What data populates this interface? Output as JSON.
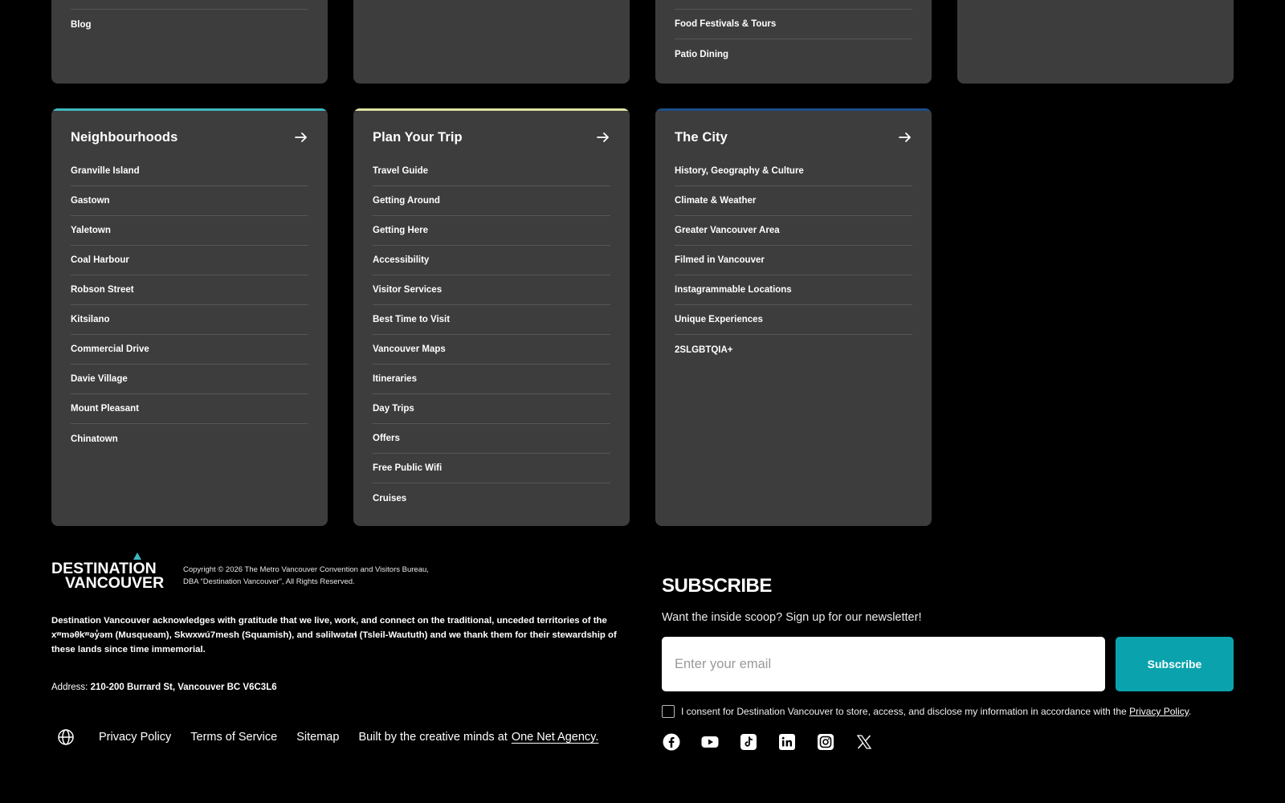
{
  "top_cards": {
    "col1": {
      "partial_item": "",
      "items": [
        "Blog"
      ]
    },
    "col3": {
      "partial_item": "",
      "items": [
        "Food Festivals & Tours",
        "Patio Dining"
      ]
    }
  },
  "cards": [
    {
      "title": "Neighbourhoods",
      "accent": "#3fb8c0",
      "items": [
        "Granville Island",
        "Gastown",
        "Yaletown",
        "Coal Harbour",
        "Robson Street",
        "Kitsilano",
        "Commercial Drive",
        "Davie Village",
        "Mount Pleasant",
        "Chinatown"
      ]
    },
    {
      "title": "Plan Your Trip",
      "accent": "#dfe3a3",
      "items": [
        "Travel Guide",
        "Getting Around",
        "Getting Here",
        "Accessibility",
        "Visitor Services",
        "Best Time to Visit",
        "Vancouver Maps",
        "Itineraries",
        "Day Trips",
        "Offers",
        "Free Public Wifi",
        "Cruises"
      ]
    },
    {
      "title": "The City",
      "accent": "#1c4f8a",
      "items": [
        "History, Geography & Culture",
        "Climate & Weather",
        "Greater Vancouver Area",
        "Filmed in Vancouver",
        "Instagrammable Locations",
        "Unique Experiences",
        "2SLGBTQIA+"
      ]
    }
  ],
  "footer": {
    "logo_line1": "DESTINATION",
    "logo_line2": "VANCOUVER",
    "copyright_line1": "Copyright © 2026 The Metro Vancouver Convention and Visitors Bureau,",
    "copyright_line2": "DBA “Destination Vancouver”, All Rights Reserved.",
    "acknowledgement": "Destination Vancouver acknowledges with gratitude that we live, work, and connect on the traditional, unceded territories of the xʷməθkʷəy̓əm (Musqueam), Skwxwú7mesh (Squamish), and səlilwətaɬ (Tsleil-Waututh) and we thank them for their stewardship of these lands since time immemorial.",
    "address_label": "Address:",
    "address_value": "210-200 Burrard St, Vancouver BC V6C3L6",
    "links": {
      "privacy": "Privacy Policy",
      "terms": "Terms of Service",
      "sitemap": "Sitemap",
      "credit": "Built by the creative minds at",
      "agency": "One Net Agency."
    }
  },
  "subscribe": {
    "title": "SUBSCRIBE",
    "text": "Want the inside scoop? Sign up for our newsletter!",
    "email_placeholder": "Enter your email",
    "button": "Subscribe",
    "consent_text": "I consent for Destination Vancouver to store, access, and disclose my information in accordance with the",
    "consent_link": "Privacy Policy",
    "consent_end": "."
  },
  "socials": [
    "facebook-icon",
    "youtube-icon",
    "tiktok-icon",
    "linkedin-icon",
    "instagram-icon",
    "x-icon"
  ],
  "colors": {
    "background": "#000000",
    "card": "#3d3d3d",
    "button": "#0aa3ad"
  }
}
